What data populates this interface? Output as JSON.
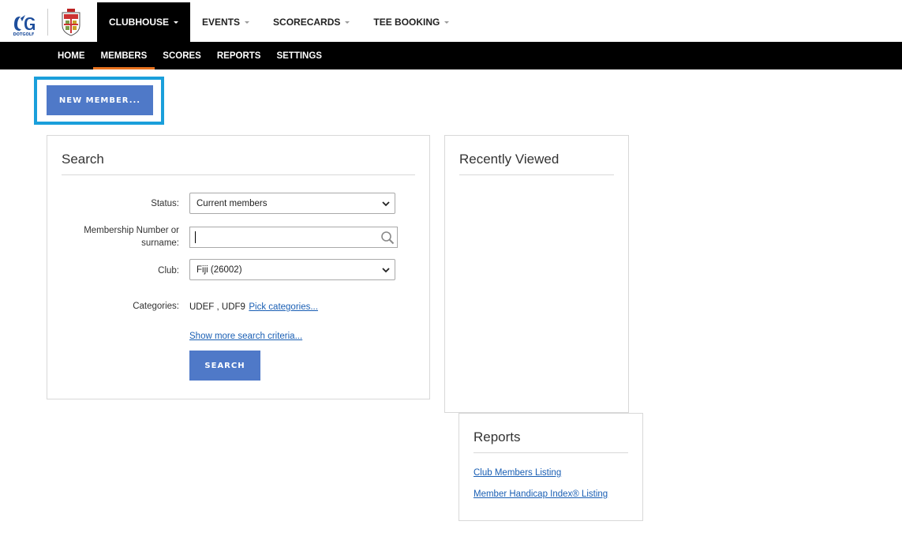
{
  "brand": {
    "logo_alt": "DOTGOLF"
  },
  "topnav": {
    "items": [
      {
        "label": "CLUBHOUSE",
        "active": true
      },
      {
        "label": "EVENTS",
        "active": false
      },
      {
        "label": "SCORECARDS",
        "active": false
      },
      {
        "label": "TEE BOOKING",
        "active": false
      }
    ]
  },
  "subnav": {
    "items": [
      {
        "label": "HOME",
        "active": false
      },
      {
        "label": "MEMBERS",
        "active": true
      },
      {
        "label": "SCORES",
        "active": false
      },
      {
        "label": "REPORTS",
        "active": false
      },
      {
        "label": "SETTINGS",
        "active": false
      }
    ]
  },
  "new_member_label": "NEW MEMBER...",
  "search": {
    "title": "Search",
    "status_label": "Status:",
    "status_value": "Current members",
    "number_label_1": "Membership Number or",
    "number_label_2": "surname:",
    "number_value": "",
    "club_label": "Club:",
    "club_value": "Fiji (26002)",
    "categories_label": "Categories:",
    "categories_value": "UDEF , UDF9",
    "pick_categories_link": "Pick categories...",
    "more_criteria_link": "Show more search criteria...",
    "search_button": "SEARCH"
  },
  "recent": {
    "title": "Recently Viewed"
  },
  "reports": {
    "title": "Reports",
    "links": [
      "Club Members Listing",
      "Member Handicap Index® Listing"
    ]
  },
  "colors": {
    "accent": "#4f79c8",
    "highlight": "#1a9fdb",
    "active_underline": "#e8731f",
    "link": "#1a5fb4"
  }
}
